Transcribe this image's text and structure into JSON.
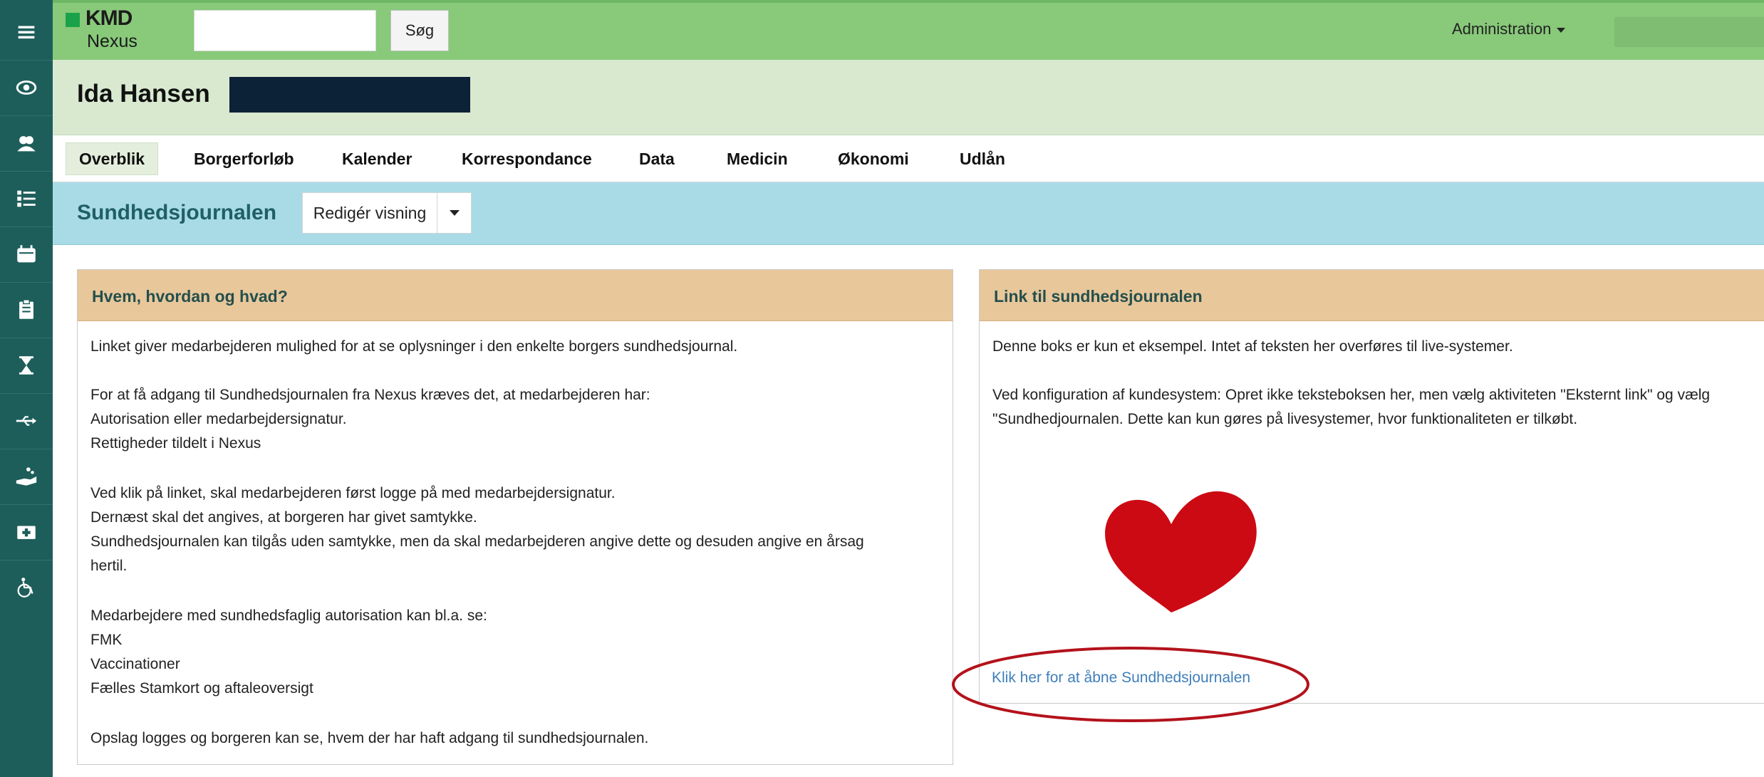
{
  "topbar": {
    "logo_kmd": "KMD",
    "logo_nexus": "Nexus",
    "search_placeholder": "",
    "search_button": "Søg",
    "admin_menu": "Administration"
  },
  "sidebar": {
    "icons": [
      "menu-icon",
      "eye-icon",
      "users-icon",
      "list-icon",
      "calendar-icon",
      "clipboard-icon",
      "hourglass-icon",
      "usb-icon",
      "hand-care-icon",
      "medical-kit-icon",
      "wheelchair-icon"
    ]
  },
  "patient": {
    "name": "Ida Hansen"
  },
  "tabs": [
    {
      "label": "Overblik"
    },
    {
      "label": "Borgerforløb"
    },
    {
      "label": "Kalender"
    },
    {
      "label": "Korrespondance"
    },
    {
      "label": "Data"
    },
    {
      "label": "Medicin"
    },
    {
      "label": "Økonomi"
    },
    {
      "label": "Udlån"
    }
  ],
  "section": {
    "title": "Sundhedsjournalen",
    "edit_view": "Redigér visning"
  },
  "left_panel": {
    "title": "Hvem, hvordan og hvad?",
    "lines": [
      "Linket giver medarbejderen mulighed for at se oplysninger i den enkelte borgers sundhedsjournal.",
      "For at få adgang til Sundhedsjournalen fra Nexus kræves det, at medarbejderen har:",
      "Autorisation eller medarbejdersignatur.",
      "Rettigheder tildelt i Nexus",
      "Ved klik på linket, skal medarbejderen først logge på med medarbejdersignatur.",
      "Dernæst skal det angives, at borgeren har givet samtykke.",
      "Sundhedsjournalen kan tilgås uden samtykke, men da skal medarbejderen angive dette og desuden angive en årsag",
      "hertil.",
      "Medarbejdere med sundhedsfaglig autorisation kan bl.a. se:",
      "FMK",
      "Vaccinationer",
      "Fælles Stamkort og aftaleoversigt",
      "Opslag logges og borgeren kan se, hvem der har haft adgang til sundhedsjournalen."
    ]
  },
  "right_panel": {
    "title": "Link til sundhedsjournalen",
    "lines": [
      "Denne boks er kun et eksempel. Intet af teksten her overføres til live-systemer.",
      "Ved konfiguration af kundesystem: Opret ikke teksteboksen her, men vælg aktiviteten \"Eksternt link\" og vælg",
      "\"Sundhedjournalen. Dette kan kun gøres på livesystemer, hvor funktionaliteten er tilkøbt."
    ],
    "link": "Klik her for at åbne Sundhedsjournalen"
  },
  "colors": {
    "sidebar": "#1d5e5a",
    "topbar": "#88c97a",
    "patient_bar": "#d8e9d0",
    "section_bar": "#a9dbe6",
    "panel_header": "#e8c79b",
    "link": "#3f7fba",
    "heart": "#cc0a14",
    "highlight_ellipse": "#b3121b"
  }
}
